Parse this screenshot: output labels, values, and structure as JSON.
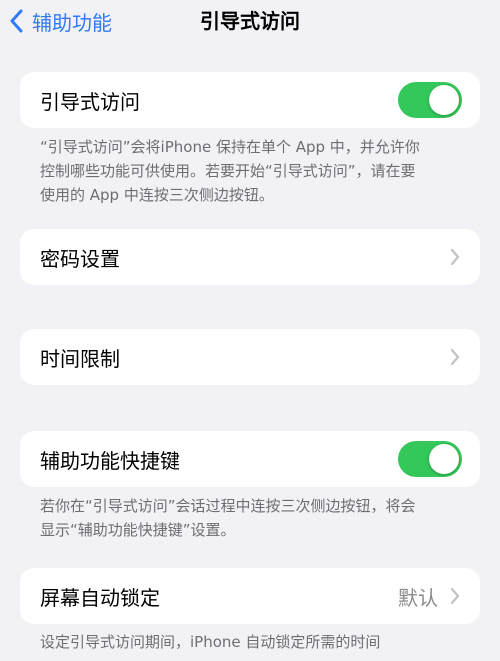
{
  "nav": {
    "back_label": "辅助功能",
    "title": "引导式访问"
  },
  "guided_access": {
    "label": "引导式访问",
    "enabled": true,
    "footnote_lines": [
      "“引导式访问”会将iPhone 保持在单个 App 中，并允许你",
      "控制哪些功能可供使用。若要开始“引导式访问”，请在要",
      "使用的 App 中连按三次侧边按钮。"
    ]
  },
  "passcode": {
    "label": "密码设置"
  },
  "time_limits": {
    "label": "时间限制"
  },
  "shortcut": {
    "label": "辅助功能快捷键",
    "enabled": true,
    "footnote_lines": [
      "若你在“引导式访问”会话过程中连按三次侧边按钮，将会",
      "显示“辅助功能快捷键”设置。"
    ]
  },
  "auto_lock": {
    "label": "屏幕自动锁定",
    "value": "默认",
    "footnote": "设定引导式访问期间，iPhone 自动锁定所需的时间"
  },
  "colors": {
    "accent": "#2f7af5",
    "toggle_on": "#34c759",
    "background": "#f2f2f6",
    "secondary_text": "#6d6d72"
  },
  "icons": {
    "back": "chevron-left-icon",
    "disclosure": "chevron-right-icon"
  }
}
